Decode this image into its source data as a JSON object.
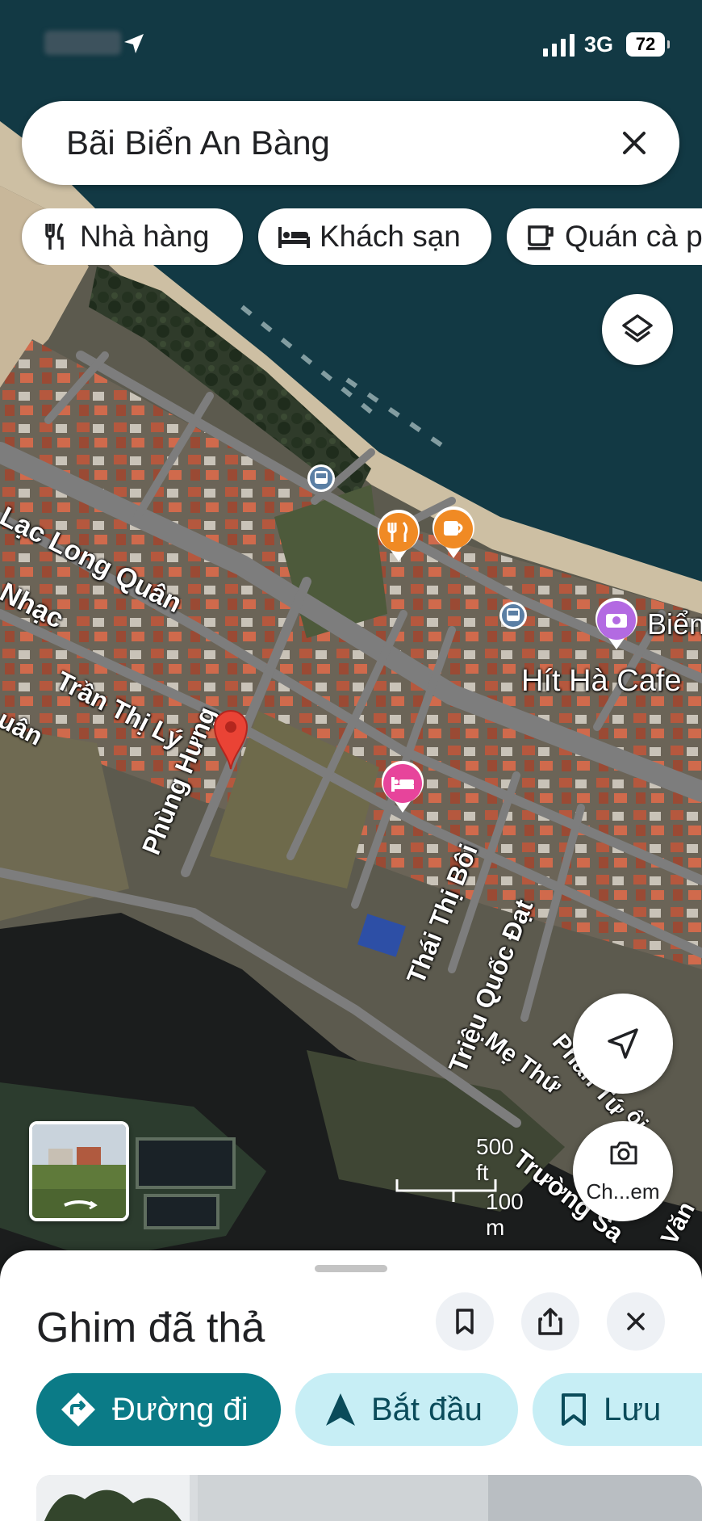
{
  "status_bar": {
    "network": "3G",
    "battery": "72"
  },
  "search": {
    "query": "Bãi Biển An Bàng"
  },
  "chips": [
    {
      "label": "Nhà hàng",
      "icon": "restaurant-icon"
    },
    {
      "label": "Khách sạn",
      "icon": "hotel-icon"
    },
    {
      "label": "Quán cà phê",
      "icon": "cafe-icon"
    }
  ],
  "map": {
    "street_labels": [
      "Lạc Long Quân",
      "Nhạc",
      "Trần Thị Lý",
      "uân",
      "Phùng Hưng",
      "Thái Thị Bôi",
      "Triệu Quốc Đạt",
      "Mẹ Thứ",
      "Trường Sa",
      "Văn",
      "Phan Tứ",
      "ôi"
    ],
    "poi_labels": [
      "Hít Hà Cafe",
      "Biển"
    ],
    "scale": {
      "feet": "500 ft",
      "meters": "100 m"
    },
    "camera_label": "Ch...em"
  },
  "sheet": {
    "title": "Ghim đã thả",
    "directions_label": "Đường đi",
    "start_label": "Bắt đầu",
    "save_label": "Lưu"
  },
  "colors": {
    "accent": "#0b7b87",
    "secondary_bg": "#c7eef5",
    "pin": "#ea4335"
  }
}
